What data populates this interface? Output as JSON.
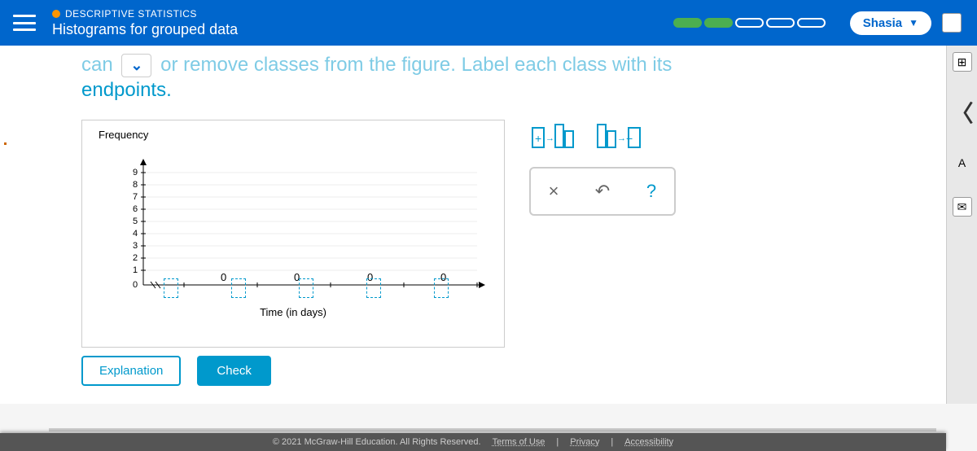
{
  "header": {
    "section": "DESCRIPTIVE STATISTICS",
    "topic": "Histograms for grouped data",
    "user": "Shasia",
    "progress_filled": 2,
    "progress_total": 5
  },
  "instruction": {
    "prefix": "can",
    "middle": "or remove classes from the figure. Label each class with its",
    "suffix": "endpoints."
  },
  "chart": {
    "y_label": "Frequency",
    "x_label": "Time (in days)",
    "y_ticks": [
      "9",
      "8",
      "7",
      "6",
      "5",
      "4",
      "3",
      "2",
      "1",
      "0"
    ],
    "bar_labels": [
      "0",
      "0",
      "0",
      "0"
    ]
  },
  "tools": {
    "add_class": "add-class-icon",
    "remove_class": "remove-class-icon",
    "close": "×",
    "undo": "↶",
    "help": "?"
  },
  "buttons": {
    "explanation": "Explanation",
    "check": "Check"
  },
  "footer": {
    "copyright": "© 2021 McGraw-Hill Education. All Rights Reserved.",
    "terms": "Terms of Use",
    "privacy": "Privacy",
    "accessibility": "Accessibility"
  },
  "chart_data": {
    "type": "bar",
    "categories": [
      "",
      "",
      "",
      ""
    ],
    "values": [
      0,
      0,
      0,
      0
    ],
    "title": "",
    "xlabel": "Time (in days)",
    "ylabel": "Frequency",
    "ylim": [
      0,
      9
    ]
  }
}
